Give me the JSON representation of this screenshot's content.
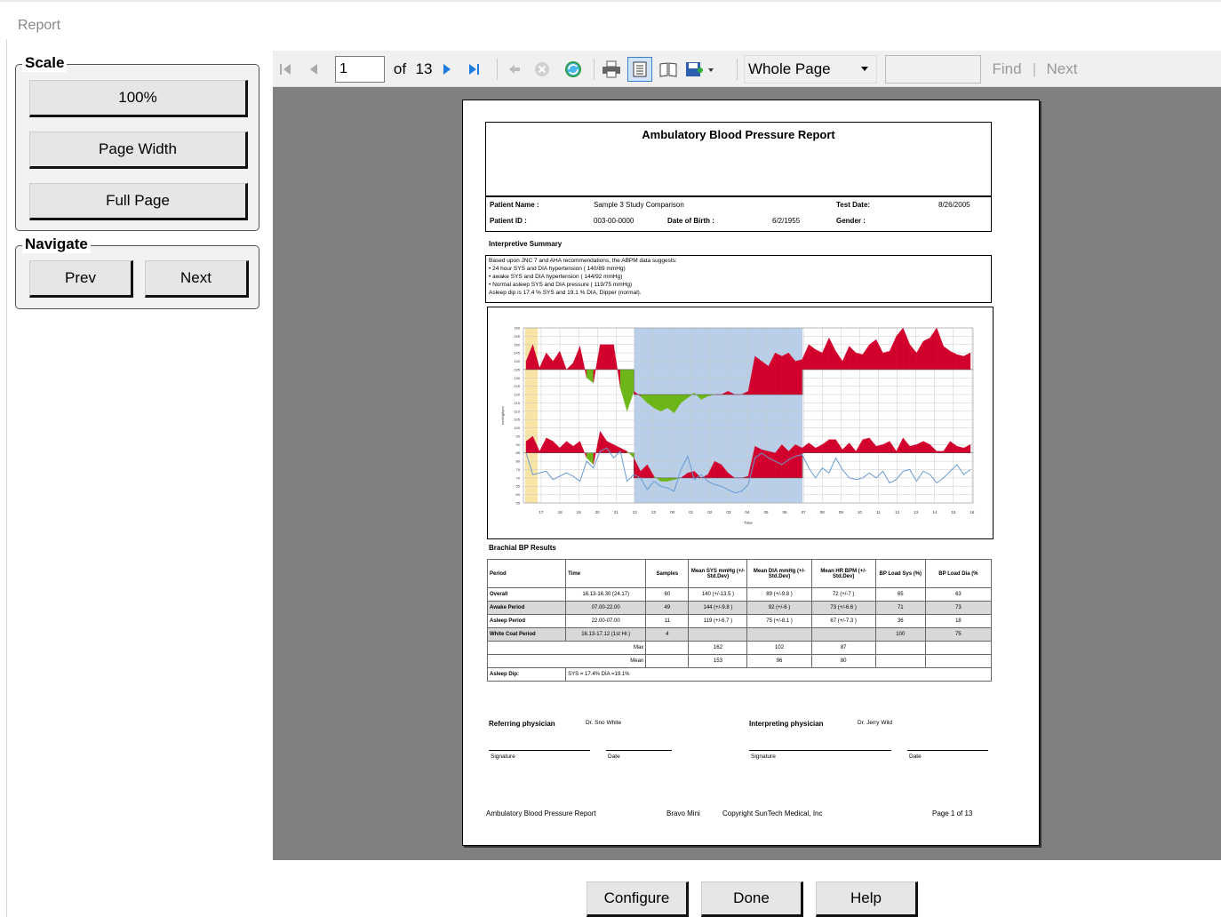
{
  "window": {
    "title": "Report"
  },
  "scale": {
    "legend": "Scale",
    "btn_100": "100%",
    "btn_page_width": "Page Width",
    "btn_full_page": "Full Page"
  },
  "navigate": {
    "legend": "Navigate",
    "prev": "Prev",
    "next": "Next"
  },
  "toolbar": {
    "page_value": "1",
    "of_label": "of",
    "total_pages": "13",
    "zoom_value": "Whole Page",
    "find_value": "",
    "find_label": "Find",
    "separator": "|",
    "next_label": "Next",
    "icons": [
      "first-page-icon",
      "prev-page-icon",
      "next-page-icon",
      "last-page-icon",
      "back-icon",
      "stop-icon",
      "refresh-icon",
      "print-icon",
      "page-layout-icon",
      "page-setup-icon",
      "export-icon"
    ]
  },
  "report": {
    "title": "Ambulatory Blood Pressure Report",
    "patient_name_label": "Patient Name :",
    "patient_name": "Sample 3 Study Comparison",
    "test_date_label": "Test Date:",
    "test_date": "8/26/2005",
    "patient_id_label": "Patient ID :",
    "patient_id": "003-00-0000",
    "dob_label": "Date of Birth :",
    "dob": "6/2/1955",
    "gender_label": "Gender :",
    "gender": "",
    "summary_heading": "Interpretive Summary",
    "summary_lines": [
      "Based upon JNC 7 and AHA recommendations, the ABPM data suggests:",
      "• 24 hour SYS and DIA hypertension ( 140/89 mmHg)",
      "• awake SYS and DIA hypertension ( 144/92 mmHg)",
      "• Normal asleep SYS and DIA pressure ( 119/75 mmHg)",
      "Asleep dip is 17.4 % SYS and 19.1 % DIA, Dipper (normal)."
    ],
    "results_heading": "Brachial BP Results",
    "table_headers": [
      "Period",
      "Time",
      "Samples",
      "Mean SYS mmHg (+/- Std.Dev)",
      "Mean DIA mmHg (+/- Std.Dev)",
      "Mean HR BPM (+/- Std.Dev)",
      "BP Load Sys (%)",
      "BP Load Dia (%"
    ],
    "table_rows": [
      [
        "Overall",
        "16.13-16.30 (24.17)",
        "60",
        "140 (+/-13.5 )",
        "89 (+/-9.8 )",
        "72 (+/-7 )",
        "65",
        "63"
      ],
      [
        "Awake Period",
        "07.00-22.00",
        "49",
        "144 (+/-9.8 )",
        "92 (+/-6 )",
        "73 (+/-6.6 )",
        "71",
        "73"
      ],
      [
        "Asleep Period",
        "22.00-07.00",
        "11",
        "119 (+/-6.7 )",
        "75 (+/-8.1 )",
        "67 (+/-7.3 )",
        "36",
        "18"
      ],
      [
        "White Coat Period",
        "16.13-17.12 (1st Hr.)",
        "4",
        "",
        "",
        "",
        "100",
        "75"
      ],
      [
        "Max",
        "",
        "",
        "162",
        "102",
        "87",
        "",
        ""
      ],
      [
        "Mean",
        "",
        "",
        "153",
        "96",
        "80",
        "",
        ""
      ]
    ],
    "asleep_dip_label": "Asleep Dip:",
    "asleep_dip_value": "SYS = 17.4% DIA =19.1%",
    "referring_label": "Referring physician",
    "referring_name": "Dr. Sno White",
    "interpreting_label": "Interpreting physician",
    "interpreting_name": "Dr. Jerry Wild",
    "signature_label": "Signature",
    "date_label": "Date",
    "footer_left": "Ambulatory Blood Pressure Report",
    "footer_mid": "Bravo Mini",
    "footer_copy": "Copyright SunTech Medical, Inc",
    "footer_page": "Page 1 of 13"
  },
  "chart_data": {
    "type": "area",
    "xlabel": "Time",
    "ylabel": "mmHg/bpm",
    "x": [
      "17",
      "18",
      "19",
      "20",
      "21",
      "22",
      "23",
      "00",
      "01",
      "02",
      "03",
      "04",
      "05",
      "06",
      "07",
      "08",
      "09",
      "10",
      "11",
      "12",
      "13",
      "14",
      "15",
      "16"
    ],
    "y_ticks": [
      "160",
      "155",
      "150",
      "145",
      "140",
      "135",
      "130",
      "125",
      "120",
      "115",
      "110",
      "105",
      "100",
      "95",
      "90",
      "85",
      "80",
      "75",
      "70",
      "65",
      "60",
      "55"
    ],
    "ylim": [
      55,
      160
    ],
    "grid": true,
    "colors": {
      "above": "#d2002d",
      "below": "#6cb619",
      "sleep_band": "#b9cfe9",
      "whitecoat_band": "#f8e4a4",
      "hr": "#6a9bd2"
    },
    "series": [
      {
        "values": [
          140,
          150,
          136,
          145,
          140,
          146,
          135,
          139,
          149,
          130,
          127,
          150,
          150,
          150,
          124,
          110,
          122,
          119,
          115,
          112,
          110,
          112,
          109,
          115,
          118,
          121,
          117,
          119,
          120,
          120,
          122,
          120,
          120,
          122,
          143,
          140,
          137,
          145,
          143,
          145,
          140,
          141,
          150,
          147,
          145,
          154,
          146,
          140,
          149,
          145,
          144,
          150,
          153,
          145,
          146,
          155,
          160,
          150,
          145,
          152,
          154,
          160,
          149,
          146,
          144,
          143,
          145
        ]
      },
      {
        "values": [
          92,
          95,
          86,
          94,
          92,
          88,
          92,
          89,
          92,
          82,
          78,
          98,
          92,
          90,
          88,
          86,
          82,
          74,
          78,
          71,
          68,
          68,
          69,
          70,
          73,
          74,
          70,
          72,
          80,
          78,
          73,
          70,
          70,
          71,
          89,
          87,
          86,
          85,
          90,
          86,
          90,
          88,
          91,
          88,
          90,
          93,
          93,
          87,
          91,
          86,
          93,
          94,
          89,
          90,
          92,
          86,
          94,
          89,
          90,
          92,
          90,
          86,
          86,
          92,
          89,
          88,
          90
        ]
      },
      {
        "values": [
          85,
          72,
          73,
          74,
          69,
          71,
          73,
          71,
          68,
          80,
          76,
          86,
          88,
          82,
          86,
          68,
          72,
          70,
          63,
          68,
          65,
          64,
          62,
          75,
          83,
          69,
          72,
          68,
          66,
          65,
          63,
          61,
          62,
          66,
          82,
          85,
          82,
          80,
          78,
          81,
          83,
          84,
          76,
          70,
          76,
          73,
          82,
          75,
          70,
          69,
          70,
          73,
          70,
          74,
          67,
          69,
          74,
          75,
          68,
          74,
          72,
          67,
          70,
          74,
          78,
          72,
          75
        ]
      }
    ]
  }
}
